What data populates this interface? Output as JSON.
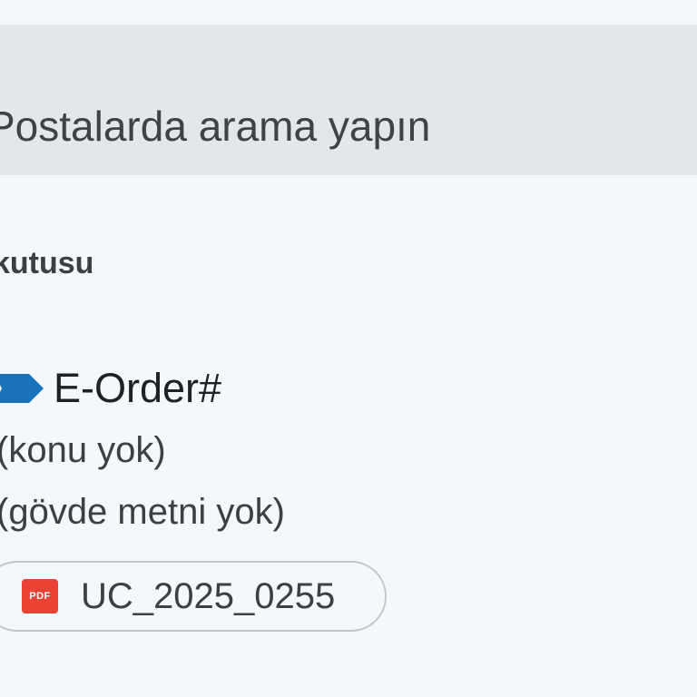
{
  "search": {
    "placeholder": "Postalarda arama yapın"
  },
  "folder": {
    "label": "kutusu"
  },
  "email": {
    "label_icon": "label-chevron-icon",
    "label_color": "#1a73b8",
    "sender": "E-Order#",
    "subject": "(konu yok)",
    "snippet": "(gövde metni yok)",
    "attachment": {
      "icon": "pdf-icon",
      "icon_text": "PDF",
      "icon_color": "#ea4335",
      "name": "UC_2025_0255"
    }
  }
}
